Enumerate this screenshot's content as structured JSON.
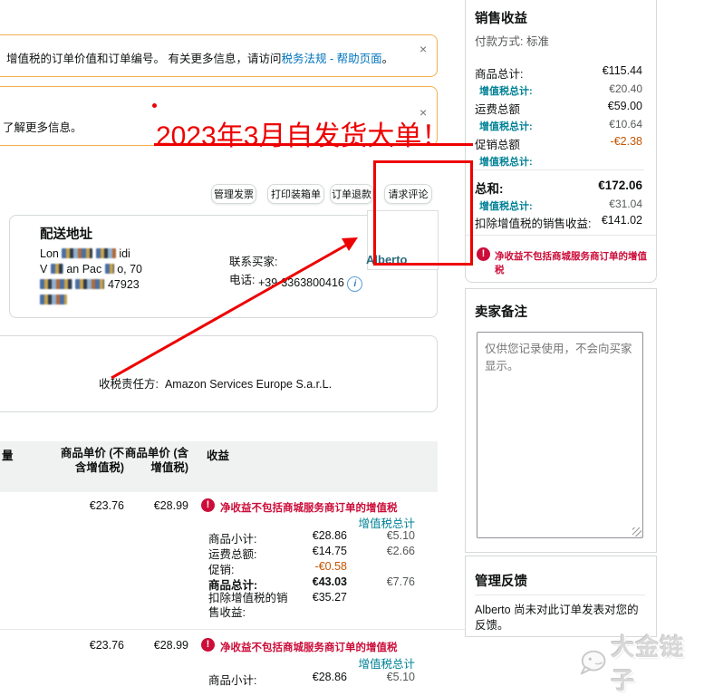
{
  "icons": {
    "close": "×",
    "warning": "!",
    "info": "i"
  },
  "notices": [
    {
      "text": "增值税的订单价值和订单编号。 有关更多信息，请访问",
      "link": "税务法规 - 帮助页面",
      "suffix": "。"
    },
    {
      "text": "了解更多信息。"
    }
  ],
  "annotation": {
    "title": "2023年3月自发货大单！"
  },
  "toolbar": {
    "manage_invoice": "管理发票",
    "print_packing_slip": "打印装箱单",
    "order_refund": "订单退款",
    "request_review": "请求评论"
  },
  "shipping": {
    "title": "配送地址",
    "line1_pre": "Lon",
    "line1_post": "idi",
    "line2_pre": "V",
    "line2_mid": "an Pac",
    "line2_post": "o, 70",
    "line3_post": "47923",
    "contact_label": "联系买家:",
    "phone_label": "电话:",
    "phone": "+39-3363800416"
  },
  "buyer": {
    "name": "Alberto"
  },
  "tax": {
    "label": "收税责任方:",
    "value": "Amazon Services Europe S.a.r.L."
  },
  "table": {
    "headers": {
      "qty": "量",
      "price_ex": "商品单价 (不含增值税)",
      "price_inc": "商品单价 (含增值税)",
      "proceeds": "收益"
    },
    "warning": "净收益不包括商城服务商订单的增值税",
    "vat_total_header": "增值税总计",
    "rows": [
      {
        "price_ex": "€23.76",
        "price_inc": "€28.99",
        "breakdown": [
          {
            "label": "商品小计:",
            "value": "€28.86",
            "vat": "€5.10"
          },
          {
            "label": "运费总额:",
            "value": "€14.75",
            "vat": "€2.66"
          },
          {
            "label": "促销:",
            "value": "-€0.58",
            "vat": ""
          },
          {
            "label": "商品总计:",
            "value": "€43.03",
            "vat": "€7.76"
          },
          {
            "label": "扣除增值税的销售收益:",
            "value": "€35.27",
            "vat": ""
          }
        ]
      },
      {
        "price_ex": "€23.76",
        "price_inc": "€28.99",
        "breakdown": [
          {
            "label": "商品小计:",
            "value": "€28.86",
            "vat": "€5.10"
          }
        ]
      }
    ]
  },
  "sidebar": {
    "sales": {
      "title": "销售收益",
      "payment": "付款方式: 标准",
      "rows": [
        {
          "label": "商品总计:",
          "value": "€115.44"
        },
        {
          "label": "增值税总计:",
          "value": "€20.40"
        },
        {
          "label": "运费总额",
          "value": "€59.00"
        },
        {
          "label": "增值税总计:",
          "value": "€10.64"
        },
        {
          "label": "促销总额",
          "value": "-€2.38"
        },
        {
          "label": "增值税总计:",
          "value": ""
        }
      ],
      "total": {
        "label": "总和:",
        "value": "€172.06"
      },
      "total_vat": {
        "label": "增值税总计:",
        "value": "€31.04"
      },
      "net": {
        "label": "扣除增值税的销售收益:",
        "value": "€141.02"
      },
      "warning": "净收益不包括商城服务商订单的增值税"
    },
    "notes": {
      "title": "卖家备注",
      "placeholder": "仅供您记录使用，不会向买家显示。"
    },
    "feedback": {
      "title": "管理反馈",
      "text": "Alberto 尚未对此订单发表对您的反馈。"
    }
  },
  "watermark": {
    "text": "大金链子"
  }
}
